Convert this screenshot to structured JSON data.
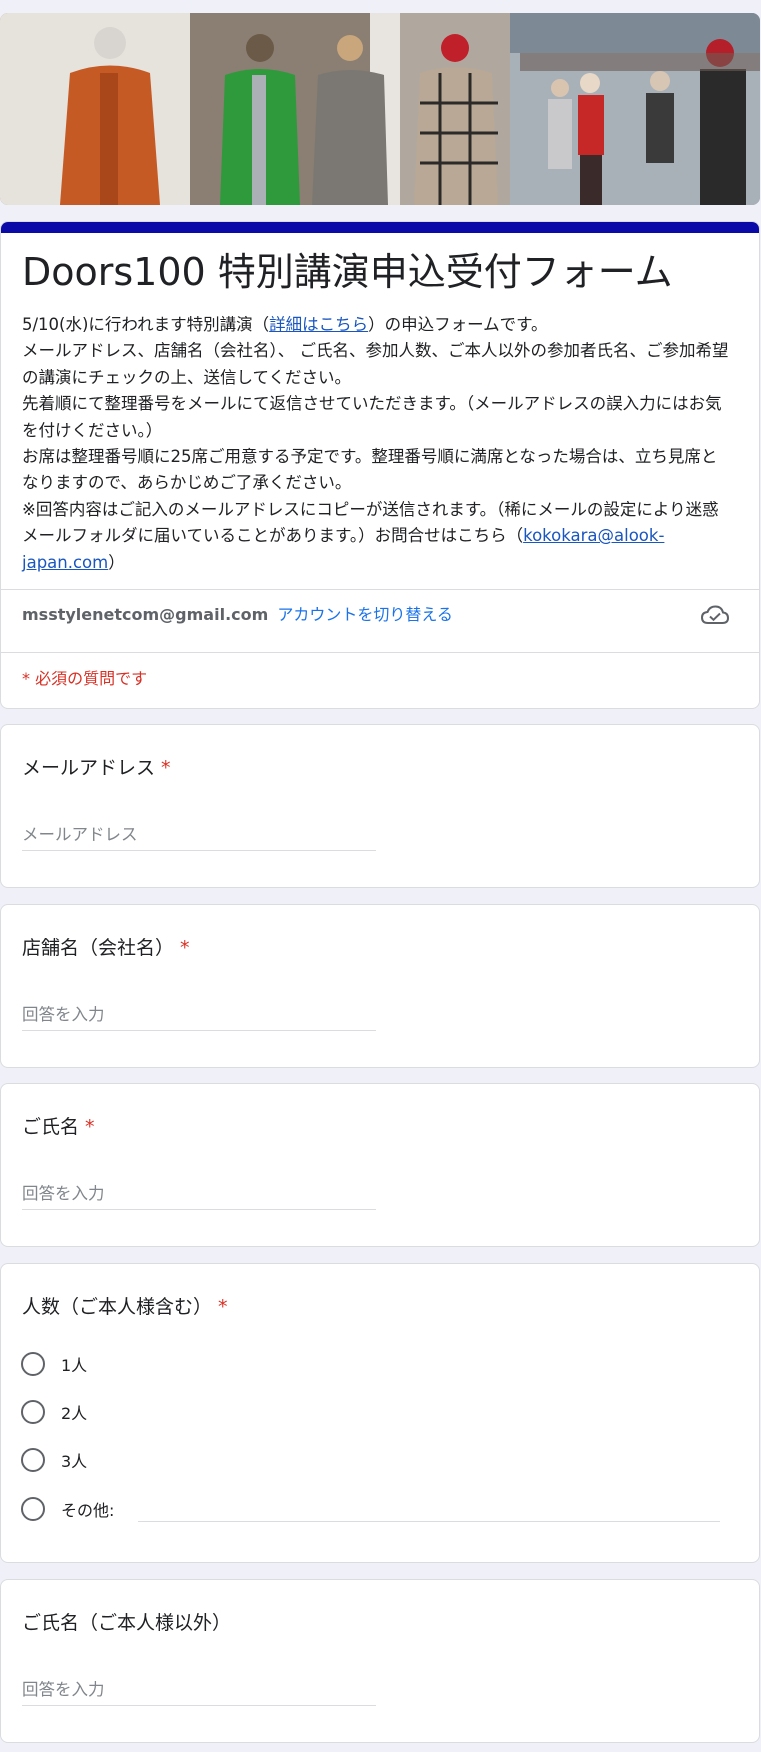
{
  "banner": {
    "alt": "fashion showroom photo"
  },
  "header": {
    "title": "Doors100 特別講演申込受付フォーム",
    "desc_line1_before": "5/10(水)に行われます特別講演（",
    "desc_link": "詳細はこちら",
    "desc_line1_after": "）の申込フォームです。",
    "desc_p2": "メールアドレス、店舗名（会社名）、 ご氏名、参加人数、ご本人以外の参加者氏名、ご参加希望の講演にチェックの上、送信してください。",
    "desc_p3": "先着順にて整理番号をメールにて返信させていただきます。（メールアドレスの誤入力にはお気を付けください。）",
    "desc_p4": "お席は整理番号順に25席ご用意する予定です。整理番号順に満席となった場合は、立ち見席となりますので、あらかじめご了承ください。",
    "desc_p5_before": "※回答内容はご記入のメールアドレスにコピーが送信されます。（稀にメールの設定により迷惑メールフォルダに届いていることがあります。）お問合せはこちら（",
    "desc_email": "kokokara@alook-japan.com",
    "desc_p5_after": "）",
    "account_email": "msstylenetcom@gmail.com",
    "switch_account": "アカウントを切り替える",
    "cloud_icon": "cloud-check-icon",
    "required_note": "* 必須の質問です"
  },
  "questions": {
    "email": {
      "title": "メールアドレス",
      "required": "*",
      "placeholder": "メールアドレス"
    },
    "shop": {
      "title": "店舗名（会社名）",
      "required": "*",
      "placeholder": "回答を入力"
    },
    "name": {
      "title": "ご氏名",
      "required": "*",
      "placeholder": "回答を入力"
    },
    "count": {
      "title": "人数（ご本人様含む）",
      "required": "*",
      "options": [
        "1人",
        "2人",
        "3人",
        "その他:"
      ]
    },
    "others": {
      "title": "ご氏名（ご本人様以外）",
      "placeholder": "回答を入力"
    }
  },
  "colors": {
    "theme": "#0a0aa8",
    "required": "#d93025",
    "link": "#1a73e8"
  }
}
